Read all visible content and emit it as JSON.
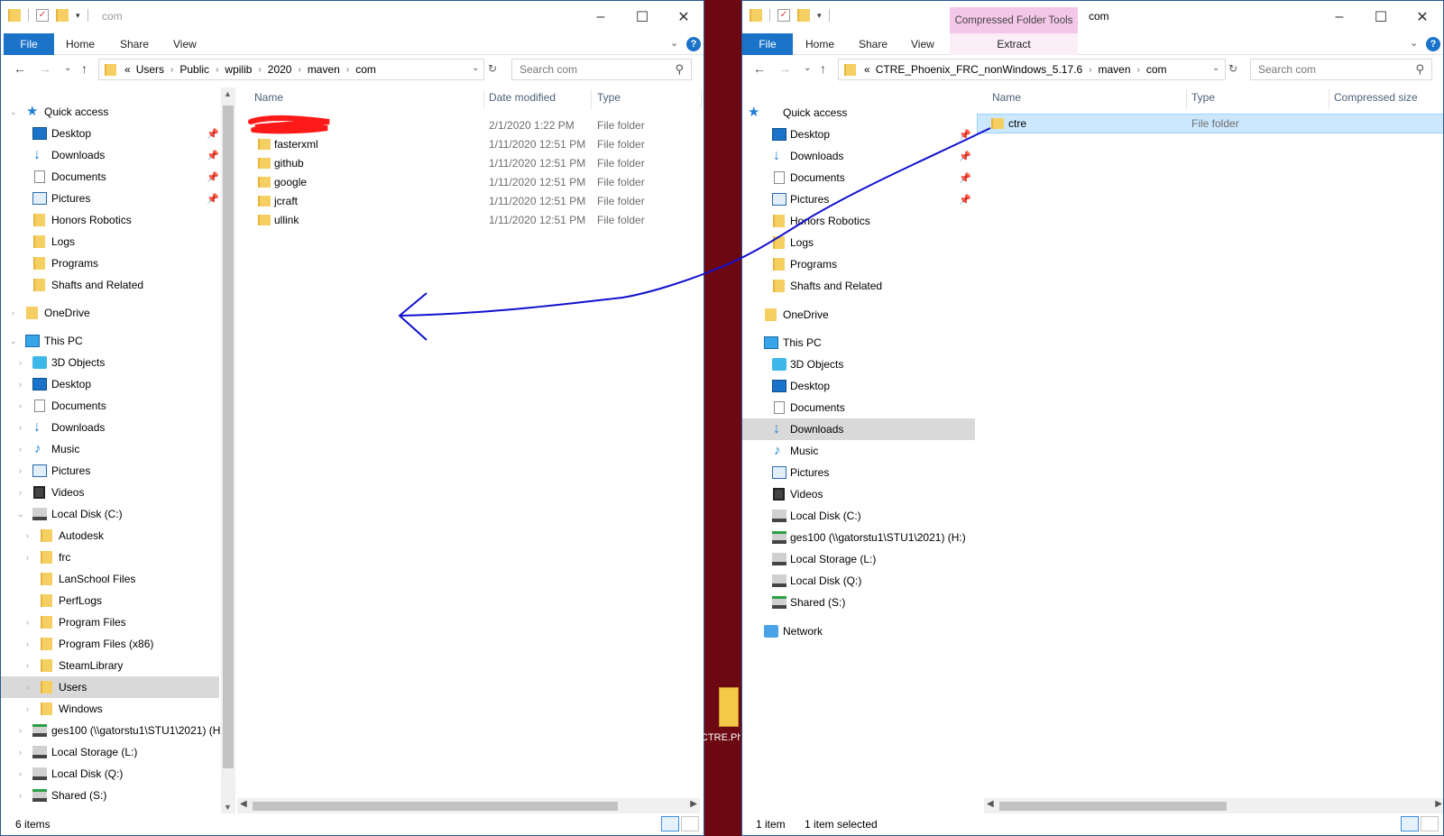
{
  "left": {
    "title": "com",
    "ribbon": {
      "file": "File",
      "home": "Home",
      "share": "Share",
      "view": "View"
    },
    "breadcrumb": {
      "prefix": "«",
      "parts": [
        "Users",
        "Public",
        "wpilib",
        "2020",
        "maven",
        "com"
      ]
    },
    "search_placeholder": "Search com",
    "nav": {
      "quick_access": "Quick access",
      "qa": [
        "Desktop",
        "Downloads",
        "Documents",
        "Pictures",
        "Honors Robotics",
        "Logs",
        "Programs",
        "Shafts and Related"
      ],
      "onedrive": "OneDrive",
      "this_pc": "This PC",
      "pc": [
        "3D Objects",
        "Desktop",
        "Documents",
        "Downloads",
        "Music",
        "Pictures",
        "Videos",
        "Local Disk (C:)"
      ],
      "c_drive": [
        "Autodesk",
        "frc",
        "LanSchool Files",
        "PerfLogs",
        "Program Files",
        "Program Files (x86)",
        "SteamLibrary",
        "Users",
        "Windows"
      ],
      "drives": [
        "ges100 (\\\\gatorstu1\\STU1\\2021) (H:",
        "Local Storage (L:)",
        "Local Disk (Q:)",
        "Shared (S:)"
      ]
    },
    "columns": {
      "name": "Name",
      "date": "Date modified",
      "type": "Type"
    },
    "files": [
      {
        "name": "",
        "date": "2/1/2020 1:22 PM",
        "type": "File folder"
      },
      {
        "name": "fasterxml",
        "date": "1/11/2020 12:51 PM",
        "type": "File folder"
      },
      {
        "name": "github",
        "date": "1/11/2020 12:51 PM",
        "type": "File folder"
      },
      {
        "name": "google",
        "date": "1/11/2020 12:51 PM",
        "type": "File folder"
      },
      {
        "name": "jcraft",
        "date": "1/11/2020 12:51 PM",
        "type": "File folder"
      },
      {
        "name": "ullink",
        "date": "1/11/2020 12:51 PM",
        "type": "File folder"
      }
    ],
    "status": "6 items"
  },
  "right": {
    "title": "com",
    "context_tab": "Compressed Folder Tools",
    "ribbon": {
      "file": "File",
      "home": "Home",
      "share": "Share",
      "view": "View",
      "extract": "Extract"
    },
    "breadcrumb": {
      "prefix": "«",
      "parts": [
        "CTRE_Phoenix_FRC_nonWindows_5.17.6",
        "maven",
        "com"
      ]
    },
    "search_placeholder": "Search com",
    "nav": {
      "quick_access": "Quick access",
      "qa": [
        "Desktop",
        "Downloads",
        "Documents",
        "Pictures",
        "Honors Robotics",
        "Logs",
        "Programs",
        "Shafts and Related"
      ],
      "onedrive": "OneDrive",
      "this_pc": "This PC",
      "pc": [
        "3D Objects",
        "Desktop",
        "Documents",
        "Downloads",
        "Music",
        "Pictures",
        "Videos",
        "Local Disk (C:)",
        "ges100 (\\\\gatorstu1\\STU1\\2021) (H:)",
        "Local Storage (L:)",
        "Local Disk (Q:)",
        "Shared (S:)"
      ],
      "network": "Network"
    },
    "columns": {
      "name": "Name",
      "type": "Type",
      "size": "Compressed size"
    },
    "files": [
      {
        "name": "ctre",
        "type": "File folder"
      }
    ],
    "status_count": "1 item",
    "status_sel": "1 item selected"
  },
  "desktop": {
    "icon_label": "CTRE.Ph"
  },
  "colors": {
    "accent": "#1a73c9",
    "annotation_ink": "#1010d0",
    "redaction": "#ff1a1a",
    "context_tab": "#f4c7e8"
  }
}
